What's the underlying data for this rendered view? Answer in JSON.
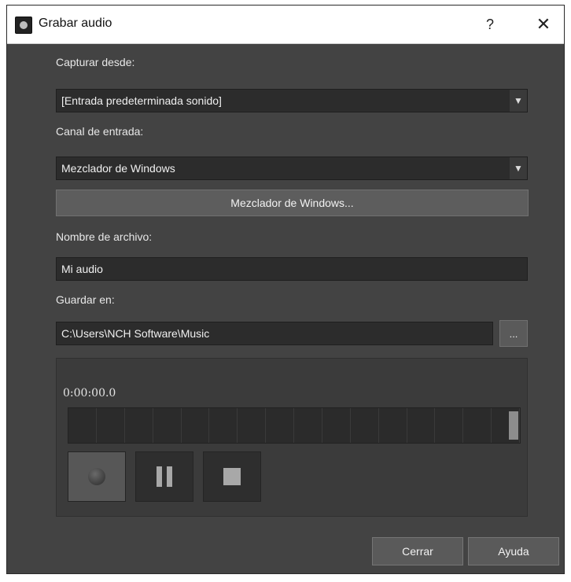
{
  "window": {
    "title": "Grabar audio",
    "help_label": "?",
    "close_label": "✕"
  },
  "capture": {
    "label": "Capturar desde:",
    "value": "[Entrada predeterminada sonido]"
  },
  "channel": {
    "label": "Canal de entrada:",
    "value": "Mezclador de Windows",
    "mixer_button": "Mezclador de Windows..."
  },
  "filename": {
    "label": "Nombre de archivo:",
    "value": "Mi audio"
  },
  "save_in": {
    "label": "Guardar en:",
    "value": "C:\\Users\\NCH Software\\Music",
    "browse_label": "..."
  },
  "recorder": {
    "time": "0:00:00.0",
    "level_segments": 16,
    "record_icon": "record-icon",
    "pause_icon": "pause-icon",
    "stop_icon": "stop-icon"
  },
  "footer": {
    "close_label": "Cerrar",
    "help_label": "Ayuda"
  }
}
